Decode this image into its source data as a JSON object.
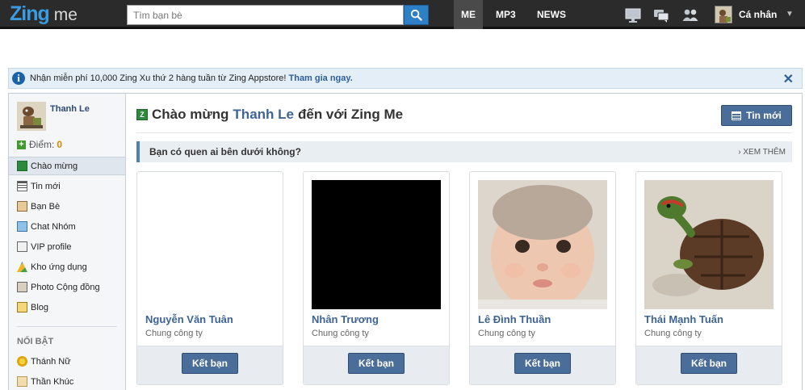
{
  "topbar": {
    "logo_text": "Zing",
    "logo_sub": "me",
    "search": {
      "placeholder": "Tìm bạn bè"
    },
    "tabs": [
      {
        "label": "ME",
        "active": true
      },
      {
        "label": "MP3",
        "active": false
      },
      {
        "label": "NEWS",
        "active": false
      }
    ],
    "user_menu_label": "Cá nhân"
  },
  "notice": {
    "text": "Nhận miễn phí 10,000 Zing Xu thứ 2 hàng tuần từ Zing Appstore! ",
    "link": "Tham gia ngay."
  },
  "sidebar": {
    "profile_name": "Thanh Le",
    "points_label": "Điểm:",
    "points_value": "0",
    "items": [
      {
        "label": "Chào mừng",
        "icon": "zing-icon",
        "active": true
      },
      {
        "label": "Tin mới",
        "icon": "newspaper-icon",
        "active": false
      },
      {
        "label": "Bạn Bè",
        "icon": "friends-icon",
        "active": false
      },
      {
        "label": "Chat Nhóm",
        "icon": "chat-icon",
        "active": false
      },
      {
        "label": "VIP profile",
        "icon": "vip-icon",
        "active": false
      },
      {
        "label": "Kho ứng dụng",
        "icon": "apps-icon",
        "active": false
      },
      {
        "label": "Photo Cộng đồng",
        "icon": "photo-icon",
        "active": false
      },
      {
        "label": "Blog",
        "icon": "blog-icon",
        "active": false
      }
    ],
    "featured_heading": "NỔI BẬT",
    "featured_items": [
      {
        "label": "Thánh Nữ",
        "icon": "flower-icon"
      },
      {
        "label": "Thần Khúc",
        "icon": "character-icon"
      }
    ]
  },
  "main": {
    "welcome_prefix": "Chào mừng",
    "welcome_name": "Thanh Le",
    "welcome_suffix": "đến với Zing Me",
    "news_button": "Tin mới",
    "suggest_question": "Bạn có quen ai bên dưới không?",
    "see_more": "XEM THÊM",
    "suggestions": [
      {
        "name": "Nguyễn Văn Tuân",
        "subtitle": "Chung công ty",
        "button": "Kết bạn",
        "photo": "blank"
      },
      {
        "name": "Nhân Trương",
        "subtitle": "Chung công ty",
        "button": "Kết bạn",
        "photo": "black"
      },
      {
        "name": "Lê Đình Thuần",
        "subtitle": "Chung công ty",
        "button": "Kết bạn",
        "photo": "baby"
      },
      {
        "name": "Thái Mạnh Tuấn",
        "subtitle": "Chung công ty",
        "button": "Kết bạn",
        "photo": "turtle"
      }
    ]
  },
  "colors": {
    "topbar": "#2b2b2b",
    "accent_blue": "#4a6d99",
    "link_blue": "#3d6494",
    "search_button": "#2d7fc6"
  }
}
